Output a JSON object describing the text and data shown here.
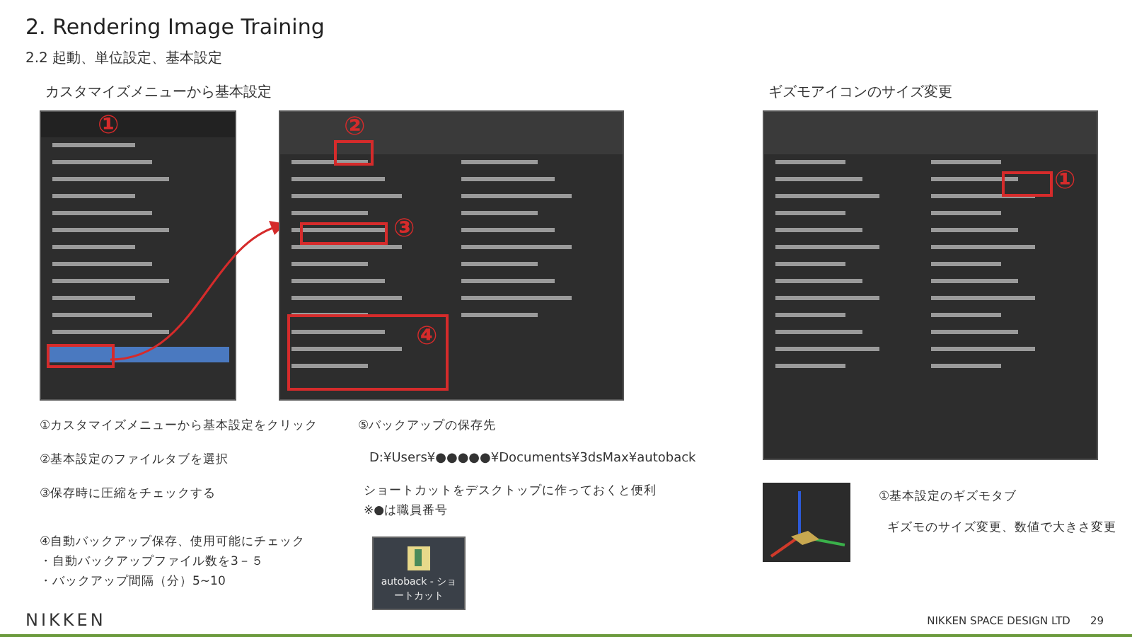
{
  "title": "2. Rendering Image Training",
  "subtitle": "2.2 起動、単位設定、基本設定",
  "left": {
    "heading": "カスタマイズメニューから基本設定",
    "menu_callout": "①",
    "dialog_callouts": [
      "②",
      "③",
      "④"
    ],
    "steps": [
      "①カスタマイズメニューから基本設定をクリック",
      "②基本設定のファイルタブを選択",
      "③保存時に圧縮をチェックする"
    ],
    "step4": [
      "④自動バックアップ保存、使用可能にチェック",
      "・自動バックアップファイル数を3－５",
      "・バックアップ間隔（分）5~10"
    ]
  },
  "backup": {
    "heading": "⑤バックアップの保存先",
    "path": "D:¥Users¥●●●●●¥Documents¥3dsMax¥autoback",
    "tips": [
      "ショートカットをデスクトップに作っておくと便利",
      "※●は職員番号"
    ],
    "shortcut_label": "autoback - ショートカット"
  },
  "right": {
    "heading": "ギズモアイコンのサイズ変更",
    "callout": "①",
    "notes": [
      "①基本設定のギズモタブ",
      "ギズモのサイズ変更、数値で大きさ変更"
    ]
  },
  "footer": {
    "logo": "NIKKEN",
    "company": "NIKKEN SPACE DESIGN LTD",
    "page": "29"
  }
}
